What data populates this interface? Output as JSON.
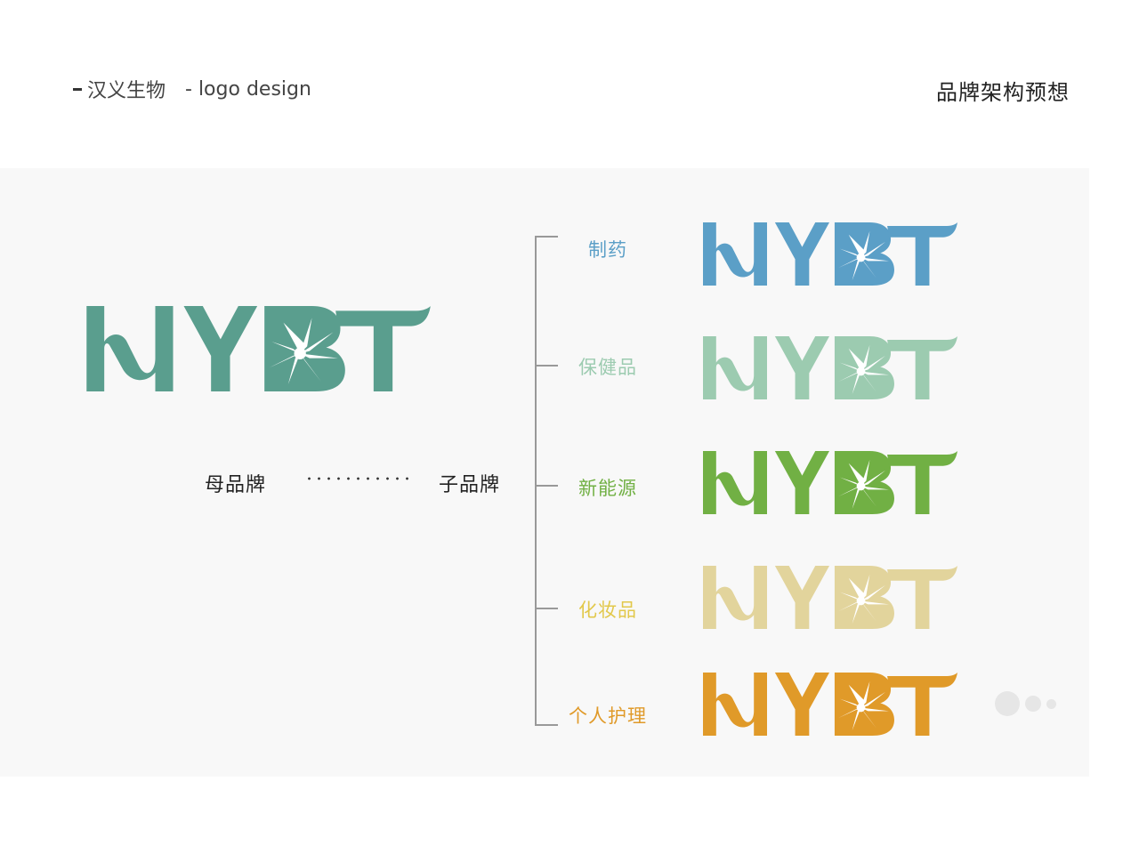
{
  "header": {
    "company": "汉义生物",
    "subtitle": "- logo design",
    "page_title": "品牌架构预想"
  },
  "logo": {
    "text": "HYBT"
  },
  "brand": {
    "parent_label": "母品牌",
    "child_label": "子品牌",
    "parent_color": "#5a9e8e"
  },
  "sub_brands": [
    {
      "label": "制药",
      "color": "#5b9fc7"
    },
    {
      "label": "保健品",
      "color": "#9ccbb0"
    },
    {
      "label": "新能源",
      "color": "#71b044"
    },
    {
      "label": "化妆品",
      "color": "#e2d49c"
    },
    {
      "label": "个人护理",
      "color": "#e09a29"
    }
  ],
  "pager": {
    "count": 3
  }
}
